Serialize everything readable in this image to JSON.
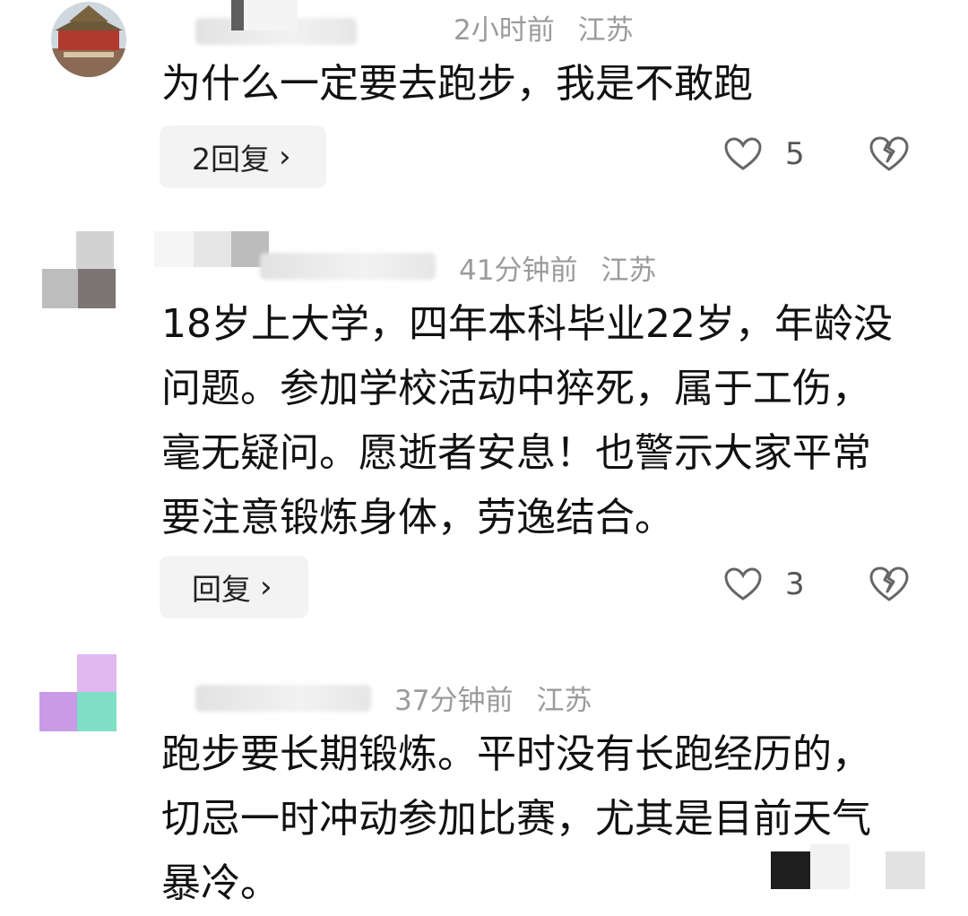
{
  "comments": [
    {
      "time": "2小时前",
      "region": "江苏",
      "text": "为什么一定要去跑步，我是不敢跑",
      "reply_label": "2回复",
      "likes": "5"
    },
    {
      "time": "41分钟前",
      "region": "江苏",
      "text": "18岁上大学，四年本科毕业22岁，年龄没问题。参加学校活动中猝死，属于工伤，毫无疑问。愿逝者安息！也警示大家平常要注意锻炼身体，劳逸结合。",
      "reply_label": "回复",
      "likes": "3"
    },
    {
      "time": "37分钟前",
      "region": "江苏",
      "text": "跑步要长期锻炼。平时没有长跑经历的，切忌一时冲动参加比赛，尤其是目前天气暴冷。"
    }
  ],
  "icons": {
    "like": "heart-outline-icon",
    "dislike": "broken-heart-icon",
    "reply_arrow": "chevron-right-icon"
  },
  "colors": {
    "meta_text": "#9b9b9b",
    "reply_bg": "#f3f3f3",
    "icon": "#666666"
  }
}
